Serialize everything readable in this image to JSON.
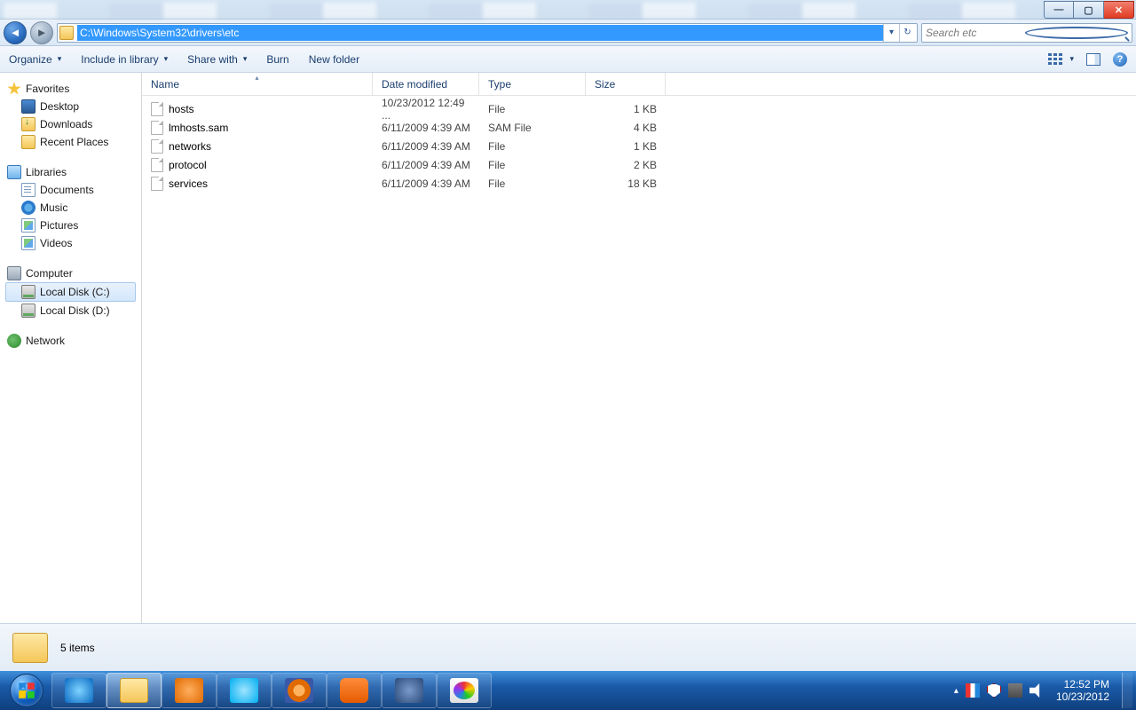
{
  "window_controls": {
    "minimize": "—",
    "maximize": "▢",
    "close": "✕"
  },
  "address": {
    "path": "C:\\Windows\\System32\\drivers\\etc",
    "search_placeholder": "Search etc"
  },
  "toolbar": {
    "organize": "Organize",
    "include": "Include in library",
    "share": "Share with",
    "burn": "Burn",
    "newfolder": "New folder"
  },
  "sidebar": {
    "favorites": {
      "label": "Favorites",
      "items": [
        "Desktop",
        "Downloads",
        "Recent Places"
      ]
    },
    "libraries": {
      "label": "Libraries",
      "items": [
        "Documents",
        "Music",
        "Pictures",
        "Videos"
      ]
    },
    "computer": {
      "label": "Computer",
      "items": [
        "Local Disk (C:)",
        "Local Disk (D:)"
      ]
    },
    "network": {
      "label": "Network"
    }
  },
  "columns": {
    "name": "Name",
    "date": "Date modified",
    "type": "Type",
    "size": "Size"
  },
  "files": [
    {
      "name": "hosts",
      "date": "10/23/2012 12:49 ...",
      "type": "File",
      "size": "1 KB"
    },
    {
      "name": "lmhosts.sam",
      "date": "6/11/2009 4:39 AM",
      "type": "SAM File",
      "size": "4 KB"
    },
    {
      "name": "networks",
      "date": "6/11/2009 4:39 AM",
      "type": "File",
      "size": "1 KB"
    },
    {
      "name": "protocol",
      "date": "6/11/2009 4:39 AM",
      "type": "File",
      "size": "2 KB"
    },
    {
      "name": "services",
      "date": "6/11/2009 4:39 AM",
      "type": "File",
      "size": "18 KB"
    }
  ],
  "status": {
    "count": "5 items"
  },
  "clock": {
    "time": "12:52 PM",
    "date": "10/23/2012"
  }
}
